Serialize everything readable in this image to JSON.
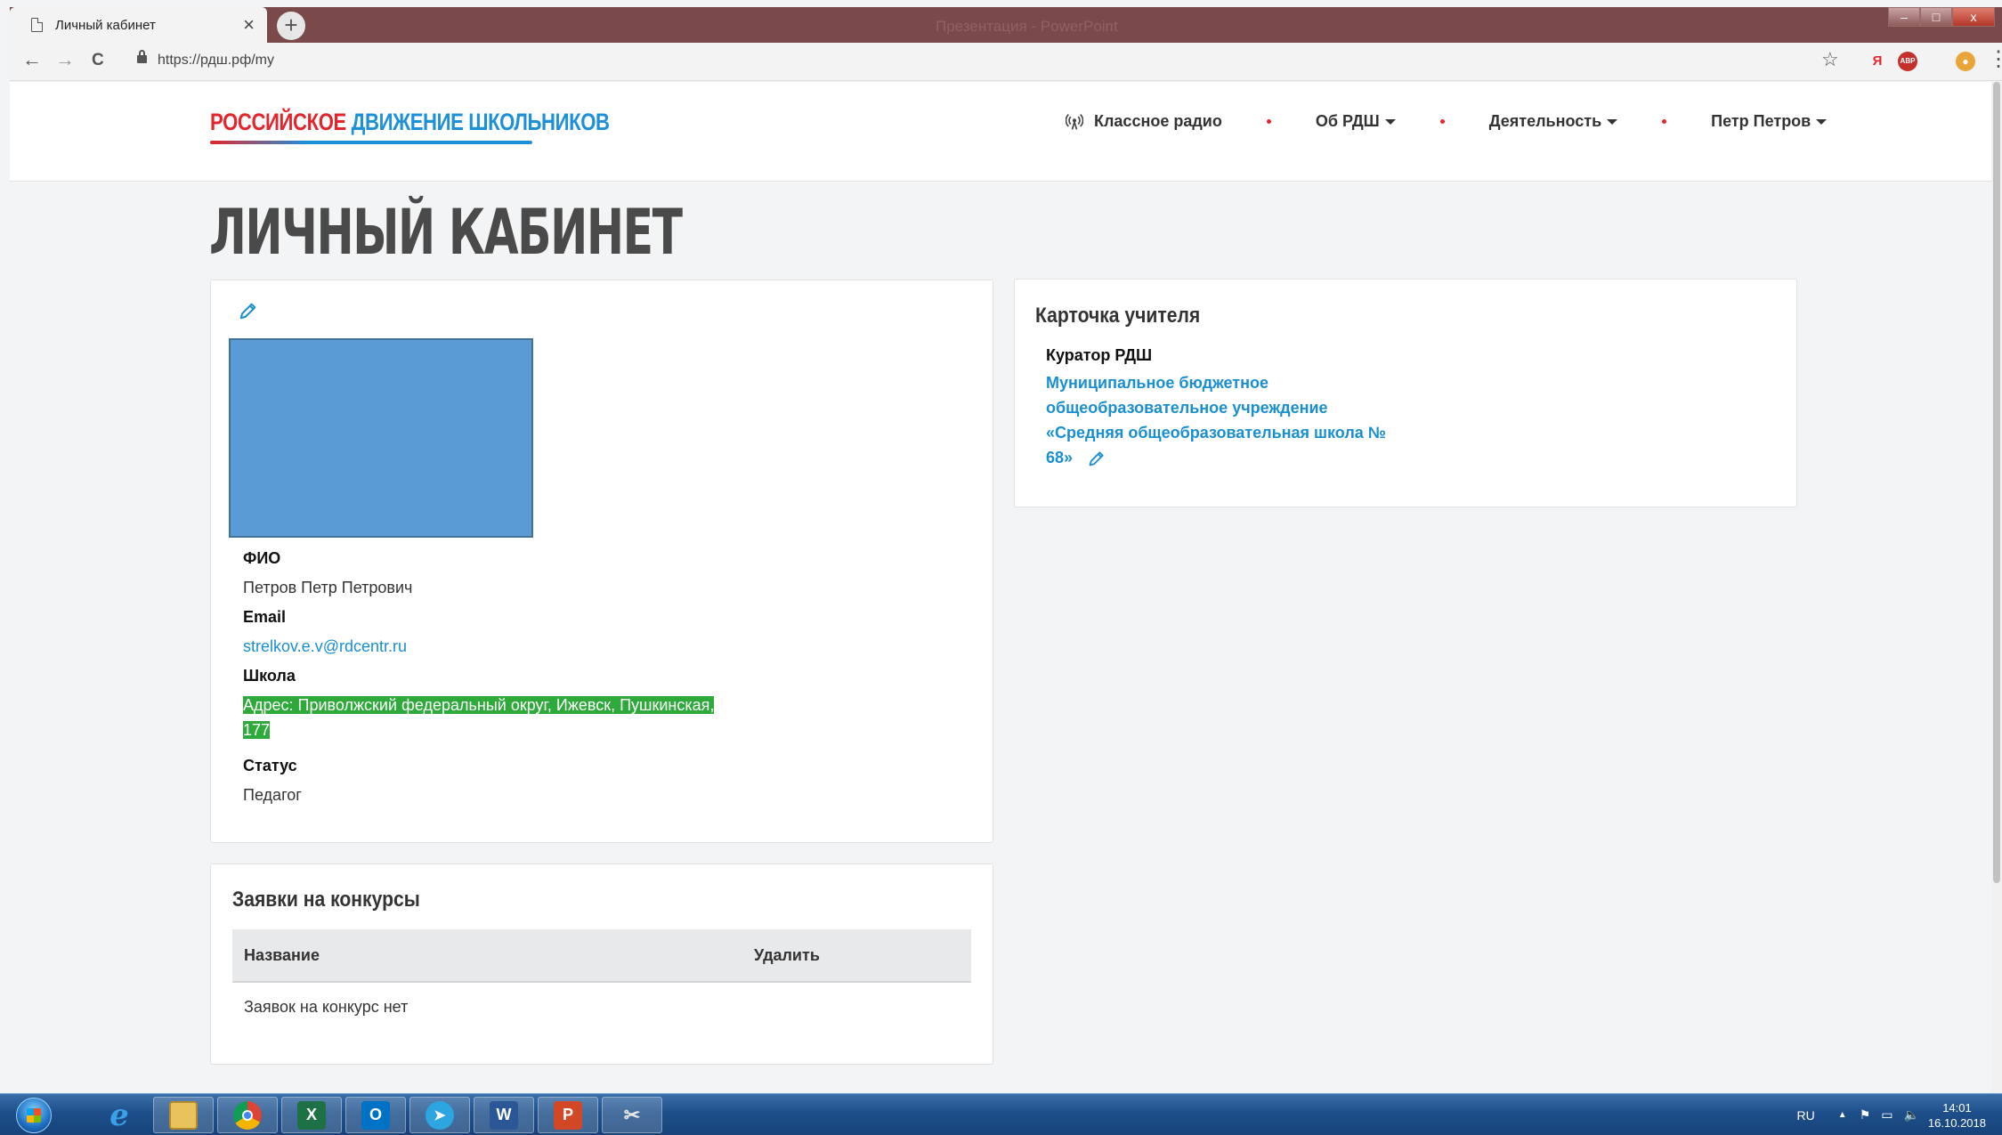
{
  "browser": {
    "tab_title": "Личный кабинет",
    "tab_close": "×",
    "new_tab": "+",
    "window_ghost_title": "Презентация - PowerPoint",
    "url": "https://рдш.рф/my",
    "back": "←",
    "forward": "→",
    "reload": "C",
    "bookmark_star": "☆",
    "menu": "⋮",
    "win_minimize": "–",
    "win_restore": "□",
    "win_close": "x",
    "extensions": [
      {
        "name": "yandex",
        "label": "Я",
        "color": "#e3262d"
      },
      {
        "name": "adblock",
        "label": "ABP",
        "color": "#c4302b"
      },
      {
        "name": "profile",
        "label": "●",
        "color": "#e8a53a"
      }
    ]
  },
  "header": {
    "logo_part1": "РОССИЙСКОЕ",
    "logo_part2": "ДВИЖЕНИЕ ШКОЛЬНИКОВ",
    "nav": {
      "radio": "Классное радио",
      "about": "Об РДШ",
      "activity": "Деятельность",
      "user": "Петр Петров"
    }
  },
  "page": {
    "title": "ЛИЧНЫЙ КАБИНЕТ"
  },
  "profile": {
    "fio_label": "ФИО",
    "fio_value": "Петров Петр Петрович",
    "email_label": "Email",
    "email_value": "strelkov.e.v@rdcentr.ru",
    "school_label": "Школа",
    "school_value_line1": "Адрес: Приволжский федеральный округ, Ижевск, Пушкинская,",
    "school_value_line2": "177",
    "status_label": "Статус",
    "status_value": "Педагог"
  },
  "teacher_card": {
    "heading": "Карточка учителя",
    "role": "Куратор РДШ",
    "school_line1": "Муниципальное бюджетное",
    "school_line2": "общеобразовательное учреждение",
    "school_line3": "«Средняя общеобразовательная школа №",
    "school_line4": "68»"
  },
  "contests": {
    "heading": "Заявки на конкурсы",
    "col_name": "Название",
    "col_delete": "Удалить",
    "empty": "Заявок на конкурс нет"
  },
  "taskbar": {
    "apps": [
      "ie",
      "explorer",
      "chrome",
      "excel",
      "outlook",
      "telegram",
      "word",
      "powerpoint",
      "snipping-tool"
    ],
    "lang": "RU",
    "time": "14:01",
    "date": "16.10.2018"
  }
}
